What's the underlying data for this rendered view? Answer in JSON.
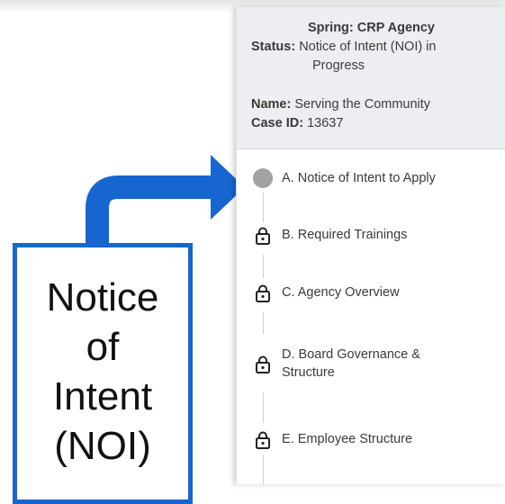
{
  "panel": {
    "title": "Spring: CRP Agency",
    "status_label": "Status:",
    "status_value_1": "Notice of Intent (NOI) in",
    "status_value_2": "Progress",
    "name_label": "Name:",
    "name_value": "Serving the Community",
    "case_label": "Case ID:",
    "case_value": "13637"
  },
  "steps": [
    {
      "label": "A. Notice of Intent to Apply",
      "icon": "circle-dot",
      "locked": false
    },
    {
      "label": "B. Required Trainings",
      "icon": "lock-icon",
      "locked": true
    },
    {
      "label": "C. Agency Overview",
      "icon": "lock-icon",
      "locked": true
    },
    {
      "label_1": "D. Board Governance &",
      "label_2": "Structure",
      "icon": "lock-icon",
      "locked": true
    },
    {
      "label": "E. Employee Structure",
      "icon": "lock-icon",
      "locked": true
    }
  ],
  "callout": {
    "line1": "Notice",
    "line2": "of",
    "line3": "Intent",
    "line4": "(NOI)",
    "color": "#1766d0"
  }
}
